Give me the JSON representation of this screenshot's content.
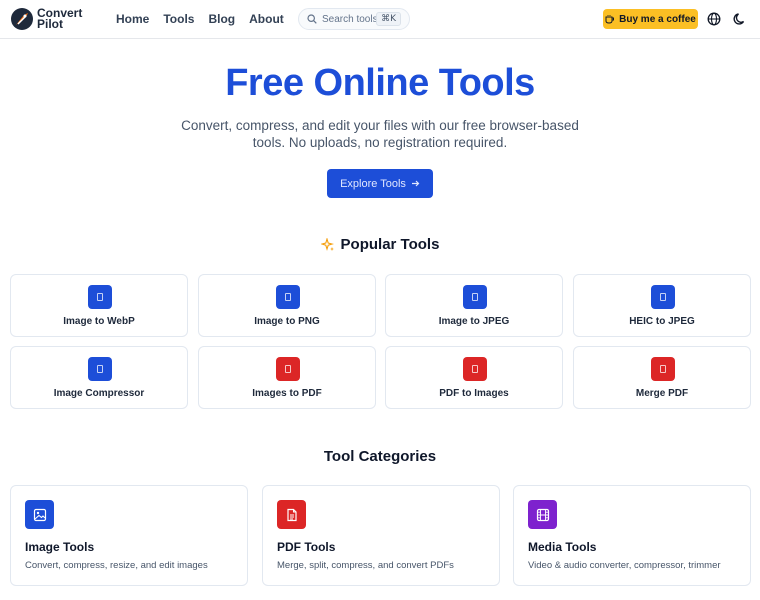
{
  "header": {
    "logo_line1": "Convert",
    "logo_line2": "Pilot",
    "nav": [
      "Home",
      "Tools",
      "Blog",
      "About"
    ],
    "search_placeholder": "Search tools...",
    "search_shortcut": "⌘K",
    "coffee_label": "Buy me a coffee"
  },
  "hero": {
    "title": "Free Online Tools",
    "subtitle": "Convert, compress, and edit your files with our free browser-based tools. No uploads, no registration required.",
    "cta_label": "Explore Tools"
  },
  "popular": {
    "heading": "Popular Tools",
    "tools": [
      {
        "name": "Image to WebP",
        "color": "#1d4ed8"
      },
      {
        "name": "Image to PNG",
        "color": "#1d4ed8"
      },
      {
        "name": "Image to JPEG",
        "color": "#1d4ed8"
      },
      {
        "name": "HEIC to JPEG",
        "color": "#1d4ed8"
      },
      {
        "name": "Image Compressor",
        "color": "#1d4ed8"
      },
      {
        "name": "Images to PDF",
        "color": "#dc2626"
      },
      {
        "name": "PDF to Images",
        "color": "#dc2626"
      },
      {
        "name": "Merge PDF",
        "color": "#dc2626"
      }
    ]
  },
  "categories": {
    "heading": "Tool Categories",
    "items": [
      {
        "title": "Image Tools",
        "description": "Convert, compress, resize, and edit images",
        "color": "#1d4ed8",
        "icon": "image-icon"
      },
      {
        "title": "PDF Tools",
        "description": "Merge, split, compress, and convert PDFs",
        "color": "#dc2626",
        "icon": "document-icon"
      },
      {
        "title": "Media Tools",
        "description": "Video & audio converter, compressor, trimmer",
        "color": "#7e22ce",
        "icon": "film-icon"
      }
    ]
  },
  "colors": {
    "brand_blue": "#1d4ed8",
    "pdf_red": "#dc2626",
    "media_purple": "#7e22ce",
    "coffee_yellow": "#fbbf24"
  }
}
